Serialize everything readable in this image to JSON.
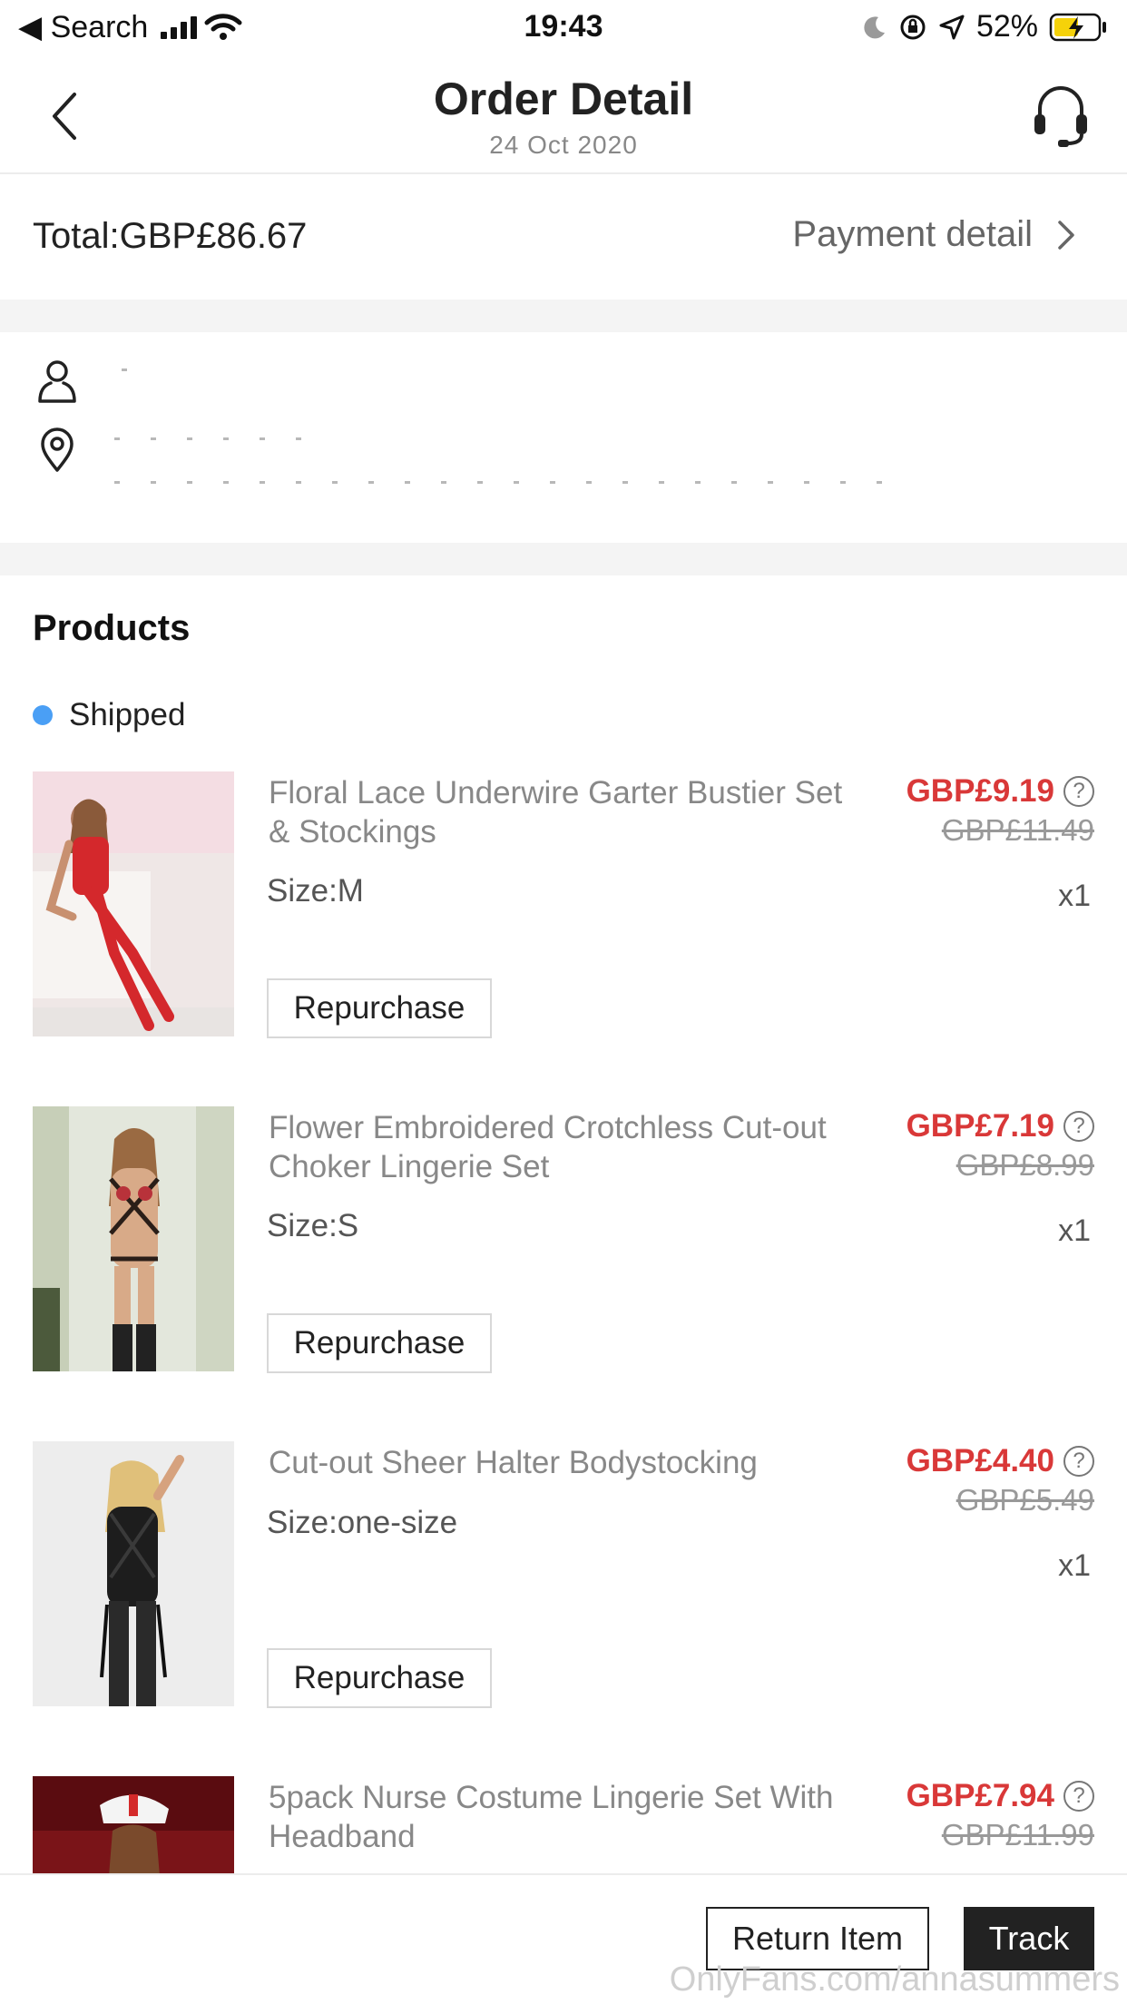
{
  "status_bar": {
    "back_app": "◀ Search",
    "time": "19:43",
    "battery": "52%"
  },
  "header": {
    "title": "Order Detail",
    "date": "24 Oct 2020"
  },
  "summary": {
    "total": "Total:GBP£86.67",
    "payment_detail": "Payment detail"
  },
  "products": {
    "heading": "Products",
    "status": "Shipped",
    "repurchase_label": "Repurchase",
    "items": [
      {
        "name": "Floral Lace Underwire Garter Bustier Set & Stockings",
        "price": "GBP£9.19",
        "old_price": "GBP£11.49",
        "size": "Size:M",
        "qty": "x1"
      },
      {
        "name": "Flower Embroidered Crotchless Cut-out Choker Lingerie Set",
        "price": "GBP£7.19",
        "old_price": "GBP£8.99",
        "size": "Size:S",
        "qty": "x1"
      },
      {
        "name": "Cut-out Sheer Halter Bodystocking",
        "price": "GBP£4.40",
        "old_price": "GBP£5.49",
        "size": "Size:one-size",
        "qty": "x1"
      },
      {
        "name": "5pack Nurse Costume Lingerie Set With Headband",
        "price": "GBP£7.94",
        "old_price": "GBP£11.99"
      }
    ]
  },
  "actions": {
    "return_item": "Return Item",
    "track": "Track"
  },
  "watermark": "OnlyFans.com/annasummers",
  "colors": {
    "price_red": "#d93838",
    "status_dot_blue": "#4a9ff5",
    "battery_yellow": "#f5d20a"
  }
}
